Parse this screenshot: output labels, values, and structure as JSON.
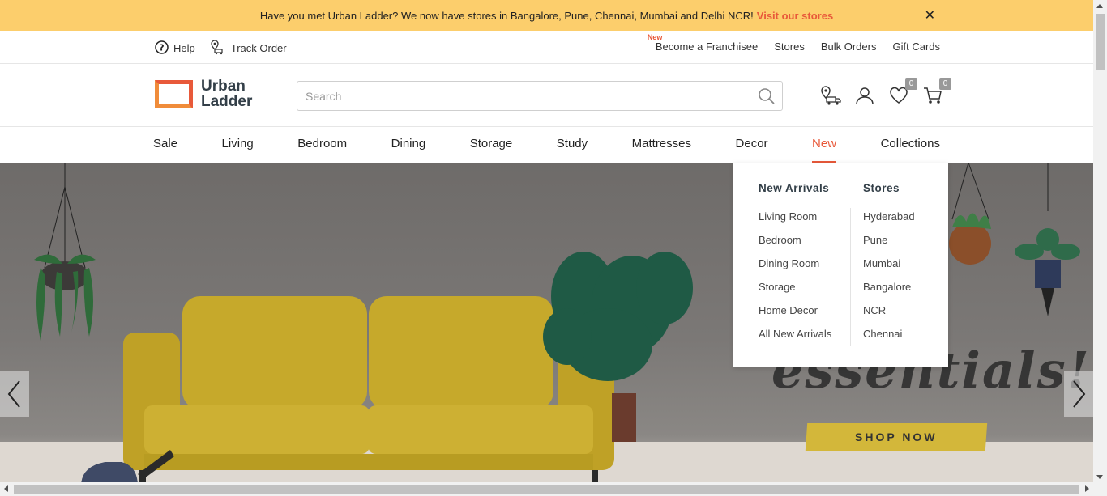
{
  "announcement": {
    "text": "Have you met Urban Ladder? We now have stores in Bangalore, Pune, Chennai, Mumbai and Delhi NCR!",
    "link": "Visit our stores",
    "close_icon": "close-icon",
    "close_symbol": "✕"
  },
  "utility": {
    "help": "Help",
    "track_order": "Track Order",
    "new_badge": "New",
    "franchise": "Become a Franchisee",
    "stores": "Stores",
    "bulk_orders": "Bulk Orders",
    "gift_cards": "Gift Cards"
  },
  "logo": {
    "line1": "Urban",
    "line2": "Ladder"
  },
  "search": {
    "placeholder": "Search",
    "value": ""
  },
  "header_icons": {
    "wishlist_count": "0",
    "cart_count": "0"
  },
  "nav": {
    "items": [
      "Sale",
      "Living",
      "Bedroom",
      "Dining",
      "Storage",
      "Study",
      "Mattresses",
      "Decor",
      "New",
      "Collections"
    ],
    "active": "New"
  },
  "dropdown": {
    "col1_title": "New Arrivals",
    "col1_links": [
      "Living Room",
      "Bedroom",
      "Dining Room",
      "Storage",
      "Home Decor",
      "All New Arrivals"
    ],
    "col2_title": "Stores",
    "col2_links": [
      "Hyderabad",
      "Pune",
      "Mumbai",
      "Bangalore",
      "NCR",
      "Chennai"
    ]
  },
  "hero": {
    "text": "essentials!",
    "cta": "SHOP NOW"
  },
  "colors": {
    "accent": "#e8593a",
    "announcement_bg": "#fcce6c",
    "sofa": "#c6a92b",
    "cta_bg": "#d3b73a"
  }
}
